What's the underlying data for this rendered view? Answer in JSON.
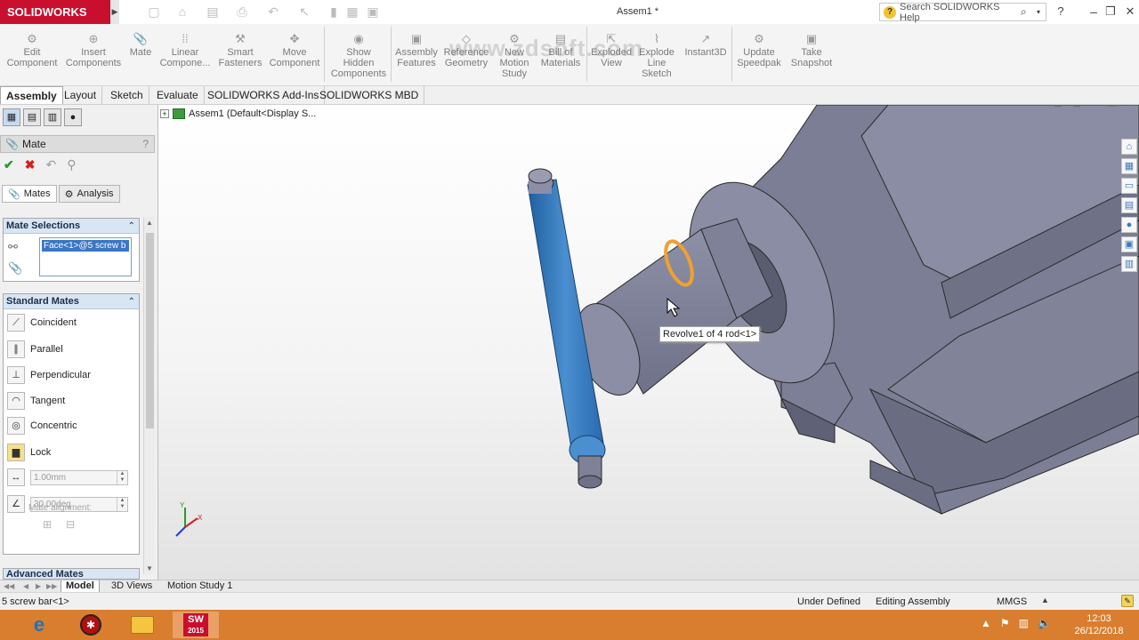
{
  "app": {
    "brand": "SOLIDWORKS",
    "document_title": "Assem1 *",
    "search_placeholder": "Search SOLIDWORKS Help",
    "watermark": "www.zdsoft.com"
  },
  "commands": [
    {
      "label": "Edit\nComponent",
      "icon": "edit-component-icon"
    },
    {
      "label": "Insert\nComponents",
      "icon": "insert-components-icon"
    },
    {
      "label": "Mate",
      "icon": "mate-icon"
    },
    {
      "label": "Linear\nCompone...",
      "icon": "linear-pattern-icon"
    },
    {
      "label": "Smart\nFasteners",
      "icon": "smart-fasteners-icon"
    },
    {
      "label": "Move\nComponent",
      "icon": "move-component-icon"
    },
    {
      "label": "Show\nHidden\nComponents",
      "icon": "show-hidden-icon"
    },
    {
      "label": "Assembly\nFeatures",
      "icon": "assembly-features-icon"
    },
    {
      "label": "Reference\nGeometry",
      "icon": "reference-geometry-icon"
    },
    {
      "label": "New\nMotion\nStudy",
      "icon": "motion-study-icon"
    },
    {
      "label": "Bill of\nMaterials",
      "icon": "bom-icon"
    },
    {
      "label": "Exploded\nView",
      "icon": "exploded-view-icon"
    },
    {
      "label": "Explode\nLine\nSketch",
      "icon": "explode-line-icon"
    },
    {
      "label": "Instant3D",
      "icon": "instant3d-icon"
    },
    {
      "label": "Update\nSpeedpak",
      "icon": "speedpak-icon"
    },
    {
      "label": "Take\nSnapshot",
      "icon": "snapshot-icon"
    }
  ],
  "command_tabs": [
    "Assembly",
    "Layout",
    "Sketch",
    "Evaluate",
    "SOLIDWORKS Add-Ins",
    "SOLIDWORKS MBD"
  ],
  "feature_tree": {
    "root": "Assem1  (Default<Display S..."
  },
  "property_manager": {
    "title": "Mate",
    "help": "?",
    "tabs": [
      "Mates",
      "Analysis"
    ],
    "selections_title": "Mate Selections",
    "selection_item": "Face<1>@5 screw b",
    "standard_title": "Standard Mates",
    "standard_mates": [
      "Coincident",
      "Parallel",
      "Perpendicular",
      "Tangent",
      "Concentric",
      "Lock"
    ],
    "distance_value": "1.00mm",
    "angle_value": "30.00deg",
    "alignment_label": "Mate alignment:",
    "advanced_title": "Advanced Mates"
  },
  "viewport": {
    "tooltip": "Revolve1 of 4 rod<1>",
    "triad_labels": [
      "Y",
      "X"
    ],
    "selected_color": "#3b7fc2",
    "hover_color": "#f0a030"
  },
  "bottom_tabs": [
    "Model",
    "3D Views",
    "Motion Study 1"
  ],
  "status": {
    "left": "5 screw bar<1>",
    "definition": "Under Defined",
    "mode": "Editing Assembly",
    "units": "MMGS"
  },
  "taskbar": {
    "time": "12:03",
    "date": "26/12/2018",
    "sw_year": "2015",
    "sw_label": "SW"
  }
}
